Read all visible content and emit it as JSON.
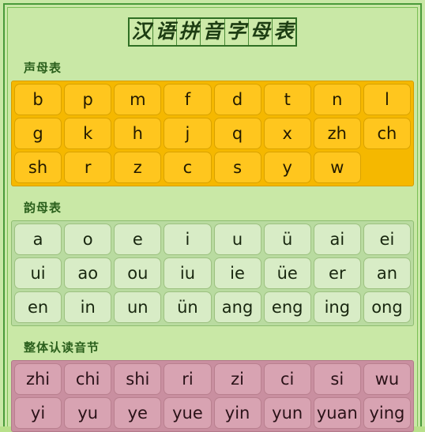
{
  "document": {
    "title_chars": [
      "汉",
      "语",
      "拼",
      "音",
      "字",
      "母",
      "表"
    ],
    "colors": {
      "page_background": "#c9e8a6",
      "frame_border": "#4a9a3a",
      "initials_block": "#f5b800",
      "initials_cell": "#ffc61e",
      "finals_block": "#b9dba0",
      "finals_cell": "#d8ecc6",
      "whole_syllable_block": "#c98fa0",
      "whole_syllable_cell": "#d8a3b2",
      "heading_text": "#2a5f1c"
    },
    "sections": [
      {
        "heading": "声母表",
        "rows": [
          [
            "b",
            "p",
            "m",
            "f",
            "d",
            "t",
            "n",
            "l"
          ],
          [
            "g",
            "k",
            "h",
            "j",
            "q",
            "x",
            "zh",
            "ch"
          ],
          [
            "sh",
            "r",
            "z",
            "c",
            "s",
            "y",
            "w",
            ""
          ]
        ]
      },
      {
        "heading": "韵母表",
        "rows": [
          [
            "a",
            "o",
            "e",
            "i",
            "u",
            "ü",
            "ai",
            "ei"
          ],
          [
            "ui",
            "ao",
            "ou",
            "iu",
            "ie",
            "üe",
            "er",
            "an"
          ],
          [
            "en",
            "in",
            "un",
            "ün",
            "ang",
            "eng",
            "ing",
            "ong"
          ]
        ]
      },
      {
        "heading": "整体认读音节",
        "rows": [
          [
            "zhi",
            "chi",
            "shi",
            "ri",
            "zi",
            "ci",
            "si",
            "wu"
          ],
          [
            "yi",
            "yu",
            "ye",
            "yue",
            "yin",
            "yun",
            "yuan",
            "ying"
          ]
        ]
      }
    ]
  }
}
